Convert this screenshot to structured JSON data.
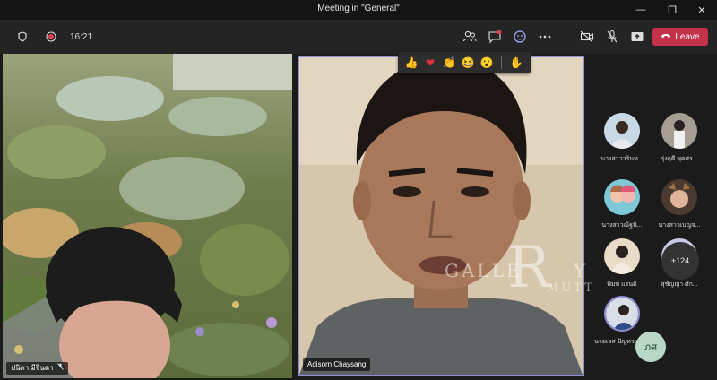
{
  "window": {
    "title": "Meeting in \"General\"",
    "controls": {
      "minimize": "—",
      "maximize": "❐",
      "close": "✕"
    }
  },
  "toolbar": {
    "timer": "16:21",
    "leave_label": "Leave",
    "icons": [
      "shield-icon",
      "record-icon",
      "people-icon",
      "chat-icon",
      "reactions-icon",
      "more-icon",
      "camera-off-icon",
      "mic-off-icon",
      "share-icon",
      "phone-icon"
    ],
    "leave_color": "#c4314b"
  },
  "reactions": [
    "👍",
    "❤",
    "👏",
    "😆",
    "😮",
    "✋"
  ],
  "tiles": {
    "left": {
      "name": "ปนิดา มีจินดา"
    },
    "main": {
      "name": "Adisorn Chaysang"
    }
  },
  "roster": [
    {
      "name": "นางสาววรินท..."
    },
    {
      "name": "รุ่งฤดี พุดศร..."
    },
    {
      "name": "นางสาวณัฐนิ..."
    },
    {
      "name": "นางสาวเบญจ..."
    },
    {
      "name": "พิมพ์ แรนดิ"
    },
    {
      "name": "สุชัญญา ศัก..."
    },
    {
      "name": "นายเอส ปัญทวงษ์ตั้ม"
    }
  ],
  "more_count": "+124",
  "self_initials": "ภศ",
  "watermark": {
    "left": "GALLE",
    "big": "R",
    "right_top": "Y",
    "sub": "MUTT"
  }
}
